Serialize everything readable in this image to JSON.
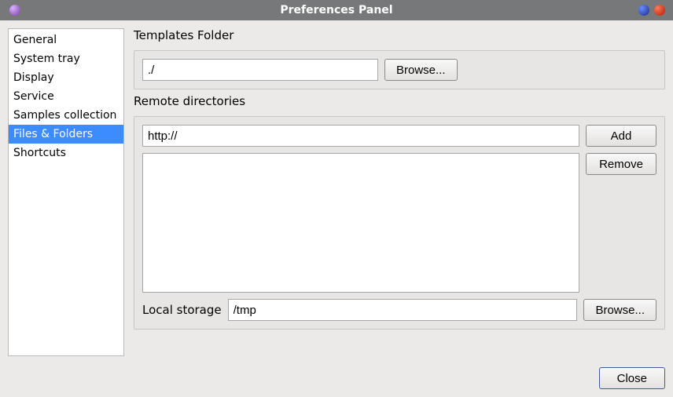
{
  "window": {
    "title": "Preferences Panel"
  },
  "sidebar": {
    "items": [
      {
        "label": "General"
      },
      {
        "label": "System tray"
      },
      {
        "label": "Display"
      },
      {
        "label": "Service"
      },
      {
        "label": "Samples collection"
      },
      {
        "label": "Files & Folders",
        "selected": true
      },
      {
        "label": "Shortcuts"
      }
    ]
  },
  "templates": {
    "label": "Templates Folder",
    "path": "./",
    "browse": "Browse..."
  },
  "remote": {
    "label": "Remote directories",
    "url": "http://",
    "add": "Add",
    "remove": "Remove",
    "local_label": "Local storage",
    "local_path": "/tmp",
    "browse": "Browse..."
  },
  "footer": {
    "close": "Close"
  }
}
